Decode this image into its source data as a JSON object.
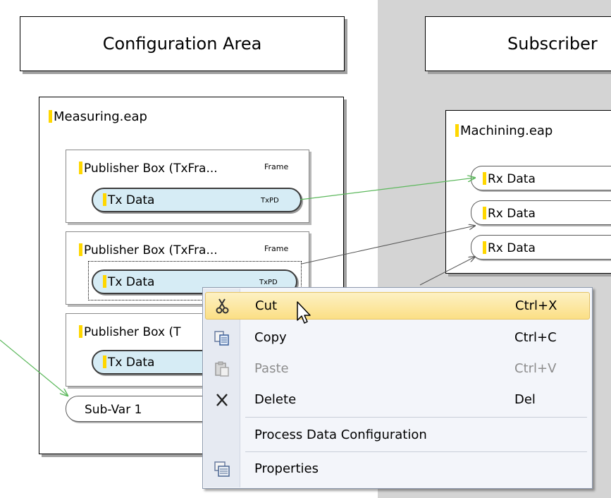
{
  "areas": {
    "configuration_title": "Configuration Area",
    "subscriber_title": "Subscriber"
  },
  "measuring": {
    "title": "Measuring.eap",
    "publishers": [
      {
        "title": "Publisher Box (TxFra...",
        "frame": "Frame",
        "pill": "Tx Data",
        "kind": "TxPD"
      },
      {
        "title": "Publisher Box (TxFra...",
        "frame": "Frame",
        "pill": "Tx Data",
        "kind": "TxPD"
      },
      {
        "title": "Publisher Box (T",
        "pill": "Tx Data"
      }
    ],
    "sub_var": "Sub-Var 1"
  },
  "machining": {
    "title": "Machining.eap",
    "rx_items": [
      "Rx Data",
      "Rx Data",
      "Rx Data"
    ]
  },
  "context_menu": {
    "items": [
      {
        "label": "Cut",
        "shortcut": "Ctrl+X",
        "icon": "scissors-icon",
        "state": "highlighted"
      },
      {
        "label": "Copy",
        "shortcut": "Ctrl+C",
        "icon": "copy-icon",
        "state": "enabled"
      },
      {
        "label": "Paste",
        "shortcut": "Ctrl+V",
        "icon": "paste-icon",
        "state": "disabled"
      },
      {
        "label": "Delete",
        "shortcut": "Del",
        "icon": "delete-x-icon",
        "state": "enabled"
      },
      {
        "label": "Process Data Configuration",
        "shortcut": "",
        "icon": "",
        "state": "enabled"
      },
      {
        "label": "Properties",
        "shortcut": "",
        "icon": "properties-icon",
        "state": "enabled"
      }
    ]
  },
  "colors": {
    "pill_fill": "#d6ecf5",
    "marker": "#ffd700",
    "link_green": "#5cb85c",
    "link_dark": "#555555",
    "menu_highlight": "#fbdf85",
    "gray_area": "#d4d4d4"
  }
}
